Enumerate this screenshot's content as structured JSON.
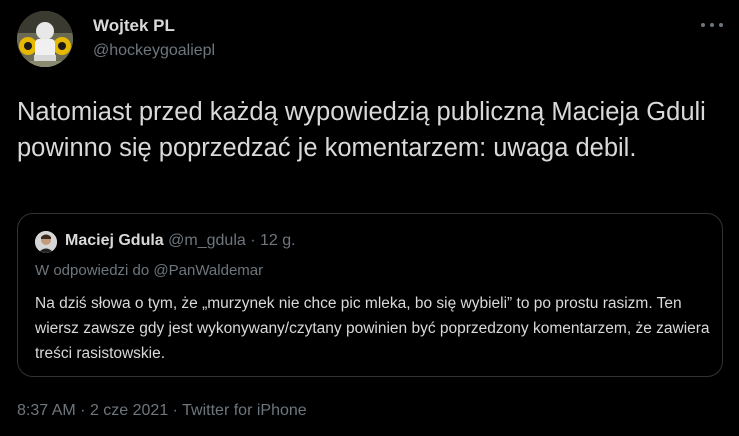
{
  "tweet": {
    "author_name": "Wojtek PL",
    "author_handle": "@hockeygoaliepl",
    "text": "Natomiast przed każdą wypowiedzią publiczną Macieja Gduli powinno się poprzedzać je komentarzem: uwaga debil.",
    "time": "8:37 AM",
    "date": "2 cze 2021",
    "source": "Twitter for iPhone",
    "separator": "·"
  },
  "quoted": {
    "author_name": "Maciej Gdula",
    "author_handle": "@m_gdula",
    "age": "12 g.",
    "separator": "·",
    "reply_prefix": "W odpowiedzi do",
    "reply_to": "@PanWaldemar",
    "text": "Na dziś słowa o tym, że „murzynek nie chce pic mleka, bo się wybieli” to po prostu rasizm. Ten wiersz zawsze gdy jest wykonywany/czytany powinien być poprzedzony komentarzem, że zawiera treści rasistowskie."
  },
  "icons": {
    "more": "more-icon"
  },
  "colors": {
    "background": "#000000",
    "text_primary": "#d9d9d9",
    "text_secondary": "#6e767d",
    "border": "#2f3336"
  }
}
